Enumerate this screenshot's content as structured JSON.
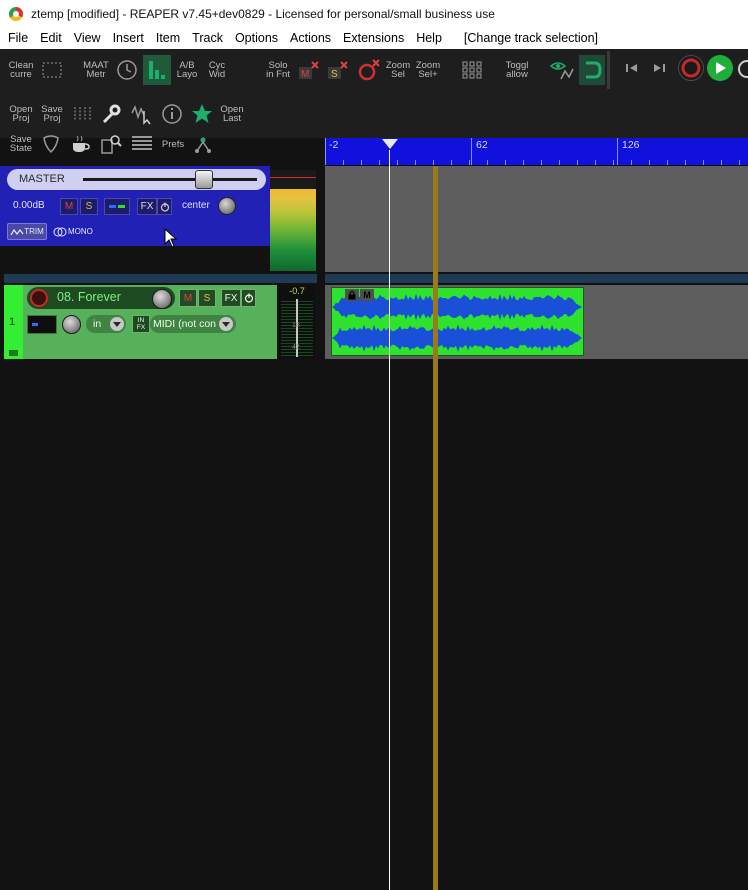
{
  "window": {
    "title": "ztemp [modified] - REAPER v7.45+dev0829 - Licensed for personal/small business use"
  },
  "menu": {
    "items": [
      "File",
      "Edit",
      "View",
      "Insert",
      "Item",
      "Track",
      "Options",
      "Actions",
      "Extensions",
      "Help"
    ],
    "extra": "[Change track selection]"
  },
  "toolbar": {
    "row1": {
      "clean_current": "Clean\ncurre",
      "maat_metr": "MAAT\nMetr",
      "ab_layo": "A/B\nLayo",
      "cyc_wid": "Cyc\nWid",
      "solo_in_fnt": "Solo\nin Fnt",
      "zoom_sel": "Zoom\nSel",
      "zoom_sel_plus": "Zoom\nSel+",
      "toggle_allow": "Toggl\nallow"
    },
    "row2": {
      "open_proj": "Open\nProj",
      "save_proj": "Save\nProj",
      "open_last": "Open\nLast"
    },
    "row3": {
      "save_state": "Save\nState",
      "prefs": "Prefs"
    },
    "colors": {
      "background": "#1e1e1e",
      "text": "#bdbdbd",
      "accent_green": "#1fae6a"
    }
  },
  "ruler": {
    "labels": [
      "-2",
      "62",
      "126"
    ],
    "color": "#1111dd"
  },
  "master": {
    "label": "MASTER",
    "volume": "0.00dB",
    "mute": "M",
    "solo": "S",
    "fx": "FX",
    "pan": "center",
    "trim": "TRIM",
    "mono": "MONO",
    "color": "#2121b6"
  },
  "tracks": [
    {
      "number": "1",
      "name": "08. Forever",
      "mute": "M",
      "solo": "S",
      "fx": "FX",
      "input": "in",
      "infx": "IN\nFX",
      "midi_input": "MIDI (not con",
      "meter_peak": "-0.7",
      "meter_ticks": [
        "18",
        "42"
      ],
      "color": "#57b05a"
    }
  ],
  "media_item": {
    "lock_icon": "lock-icon",
    "mute_label": "M",
    "waveform_color": "#1a4fd8",
    "item_color": "#2ee22e"
  },
  "transport": {
    "record_color": "#c62828",
    "play_color": "#1fae3a"
  }
}
